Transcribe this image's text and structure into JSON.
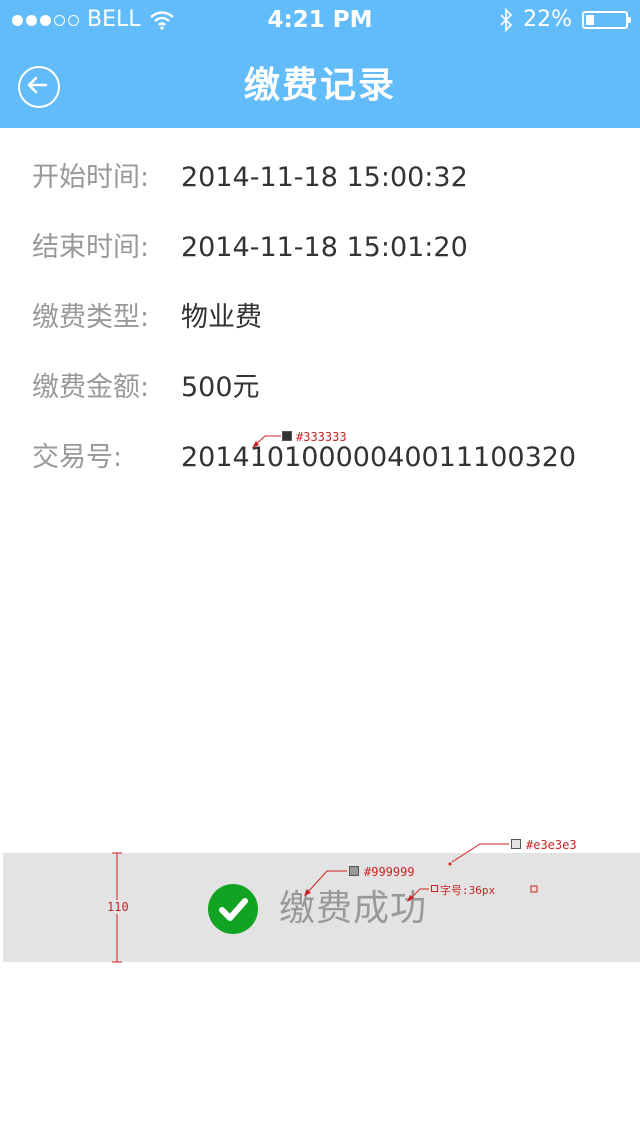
{
  "status_bar": {
    "carrier": "BELL",
    "time": "4:21 PM",
    "battery": "22%",
    "battery_level": 0.22,
    "signal_bars": 3,
    "signal_total": 5
  },
  "header": {
    "title": "缴费记录",
    "back_icon": "back-arrow-icon",
    "background": "#62bcfa"
  },
  "details": [
    {
      "label": "开始时间:",
      "value": "2014-11-18  15:00:32"
    },
    {
      "label": "结束时间:",
      "value": "2014-11-18  15:01:20"
    },
    {
      "label": "缴费类型:",
      "value": "物业费"
    },
    {
      "label": "缴费金额:",
      "value": "500元"
    },
    {
      "label": "交易号:",
      "value": "20141010000040011100320"
    }
  ],
  "success": {
    "text": "缴费成功",
    "icon": "check-circle-icon",
    "icon_color": "#13a323",
    "background": "#e3e3e3"
  },
  "annotations": {
    "value_color": "#333333",
    "text_color": "#999999",
    "bar_color": "#e3e3e3",
    "font_size": "字号:36px",
    "bar_height": "110"
  }
}
